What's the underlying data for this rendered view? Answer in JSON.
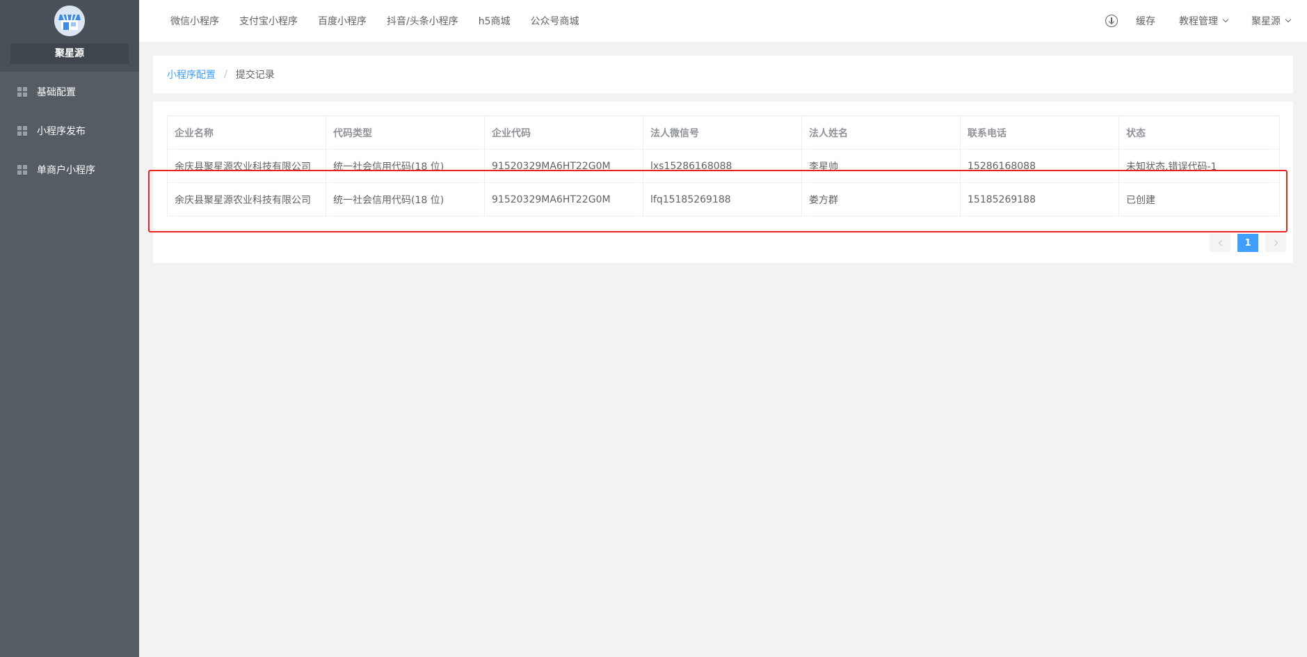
{
  "sidebar": {
    "brand": "聚星源",
    "items": [
      {
        "label": "基础配置"
      },
      {
        "label": "小程序发布"
      },
      {
        "label": "单商户小程序"
      }
    ]
  },
  "header": {
    "nav": [
      {
        "label": "微信小程序"
      },
      {
        "label": "支付宝小程序"
      },
      {
        "label": "百度小程序"
      },
      {
        "label": "抖音/头条小程序"
      },
      {
        "label": "h5商城"
      },
      {
        "label": "公众号商城"
      }
    ],
    "cache_label": "缓存",
    "tutorial_label": "教程管理",
    "user_label": "聚星源"
  },
  "breadcrumb": {
    "parent": "小程序配置",
    "separator": "/",
    "current": "提交记录"
  },
  "table": {
    "columns": [
      "企业名称",
      "代码类型",
      "企业代码",
      "法人微信号",
      "法人姓名",
      "联系电话",
      "状态"
    ],
    "rows": [
      [
        "余庆县聚星源农业科技有限公司",
        "统一社会信用代码(18 位)",
        "91520329MA6HT22G0M",
        "lxs15286168088",
        "李星帅",
        "15286168088",
        "未知状态,错误代码-1"
      ],
      [
        "余庆县聚星源农业科技有限公司",
        "统一社会信用代码(18 位)",
        "91520329MA6HT22G0M",
        "lfq15185269188",
        "娄方群",
        "15185269188",
        "已创建"
      ]
    ]
  },
  "pagination": {
    "current_page": "1"
  },
  "colors": {
    "sidebar_bg": "#555c64",
    "accent": "#409eff",
    "highlight": "#e8231d"
  }
}
